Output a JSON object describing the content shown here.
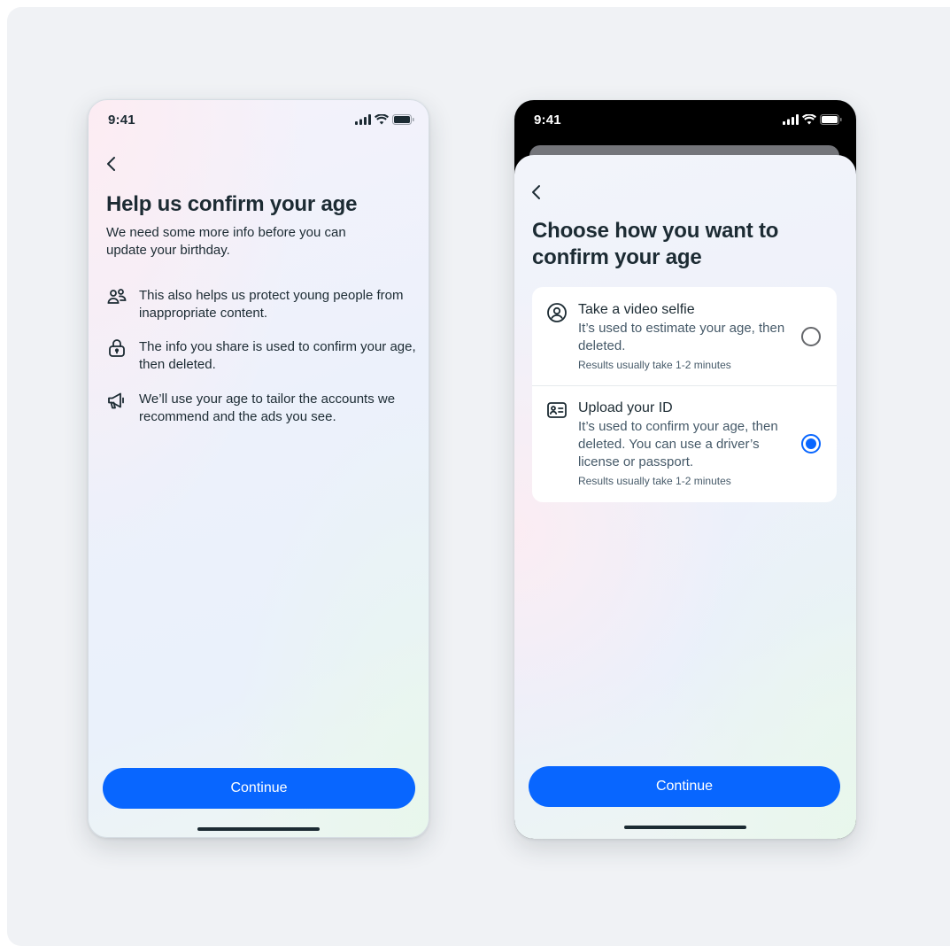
{
  "screen1": {
    "status_time": "9:41",
    "title": "Help us confirm your age",
    "subtitle": "We need some more info before you can update your birthday.",
    "items": [
      {
        "icon": "people-icon",
        "text": "This also helps us protect young people from inappropriate content."
      },
      {
        "icon": "lock-icon",
        "text": "The info you share is used to confirm your age, then deleted."
      },
      {
        "icon": "megaphone-icon",
        "text": "We’ll use your age to tailor the accounts we recommend and the ads you see."
      }
    ],
    "continue_label": "Continue"
  },
  "screen2": {
    "status_time": "9:41",
    "title": "Choose how you want to confirm your age",
    "options": [
      {
        "icon": "person-circle-icon",
        "title": "Take a video selfie",
        "description": "It’s used to estimate your age, then deleted.",
        "note": "Results usually take 1-2 minutes",
        "selected": false
      },
      {
        "icon": "id-card-icon",
        "title": "Upload your ID",
        "description": "It’s used to confirm your age, then deleted. You can use a driver’s license or passport.",
        "note": "Results usually take 1-2 minutes",
        "selected": true
      }
    ],
    "continue_label": "Continue"
  },
  "colors": {
    "primary": "#0866ff",
    "text": "#1c2b33",
    "secondary_text": "#465a69",
    "background": "#f0f2f5"
  }
}
